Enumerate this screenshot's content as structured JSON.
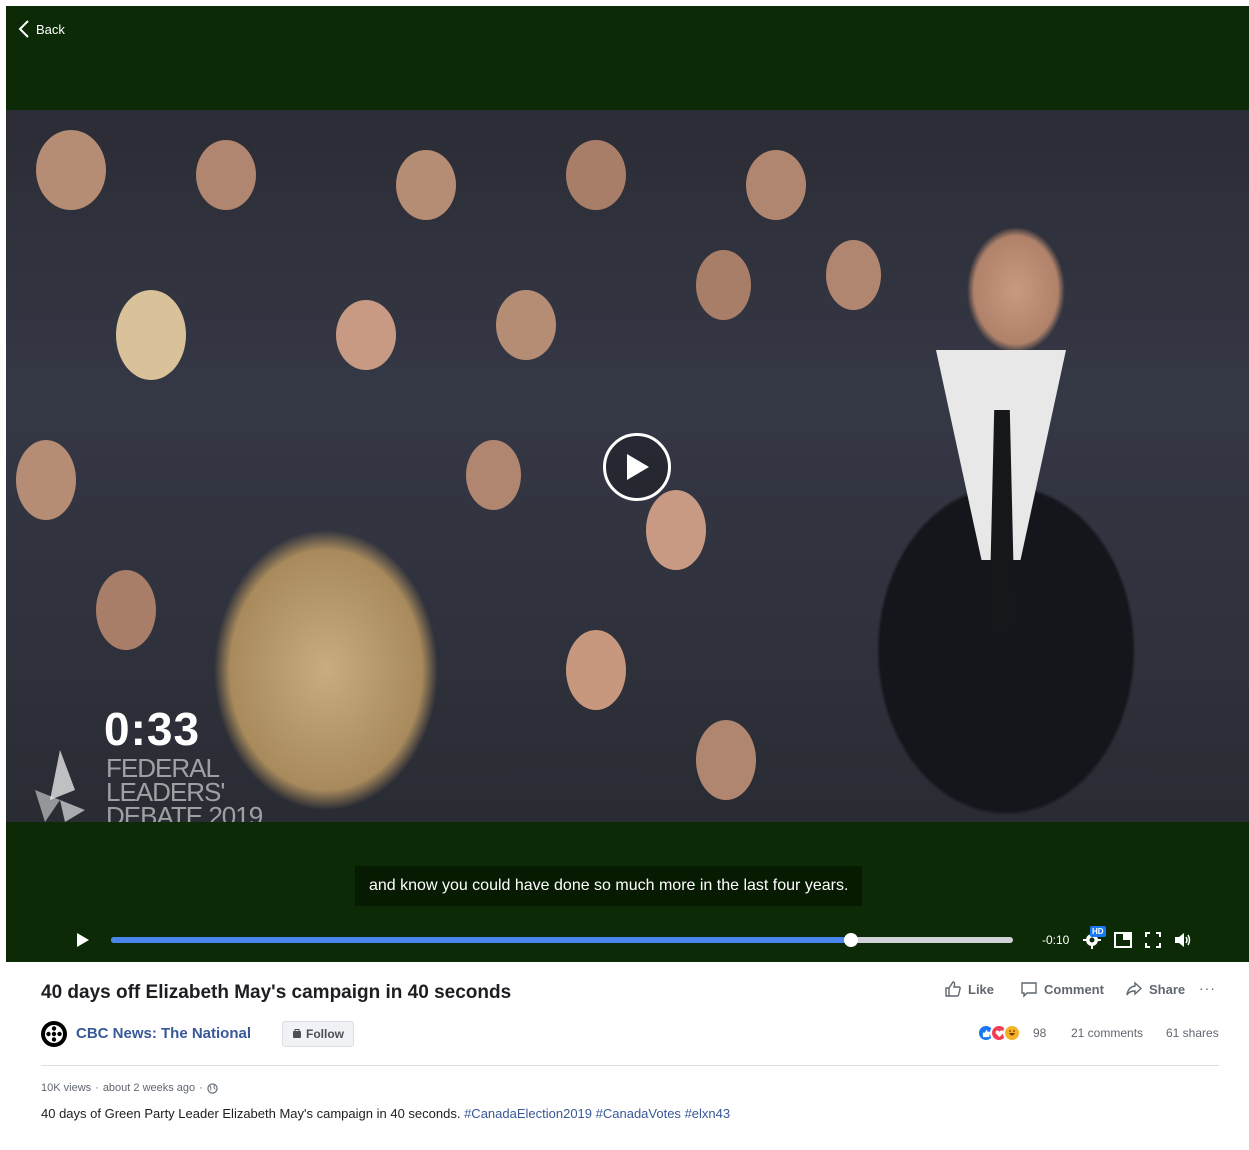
{
  "player": {
    "back_label": "Back",
    "video_overlay": {
      "duration": "0:33",
      "debate_lines": [
        "FEDERAL",
        "LEADERS'",
        "DEBATE 2019"
      ]
    },
    "caption": "and know you could have done so much more in the last four years.",
    "time_remaining": "-0:10",
    "progress": 0.82,
    "hd_label": "HD"
  },
  "video": {
    "title": "40 days off Elizabeth May's campaign in 40 seconds",
    "actions": {
      "like": "Like",
      "comment": "Comment",
      "share": "Share",
      "more": "···"
    },
    "page_name": "CBC News: The National",
    "follow_label": "Follow",
    "reaction_count": "98",
    "comments": "21 comments",
    "shares": "61 shares",
    "meta": {
      "views": "10K views",
      "sep": "·",
      "time": "about 2 weeks ago",
      "sep2": "·"
    },
    "description": {
      "text": "40 days of Green Party Leader Elizabeth May's campaign in 40 seconds.",
      "hashtags": [
        "#CanadaElection2019",
        "#CanadaVotes",
        "#elxn43"
      ]
    }
  },
  "colors": {
    "player_bg": "#0c2a06",
    "progress": "#4a86ec",
    "link": "#385898",
    "like": "#1877f2",
    "love": "#f33e58",
    "haha": "#f7b125"
  }
}
